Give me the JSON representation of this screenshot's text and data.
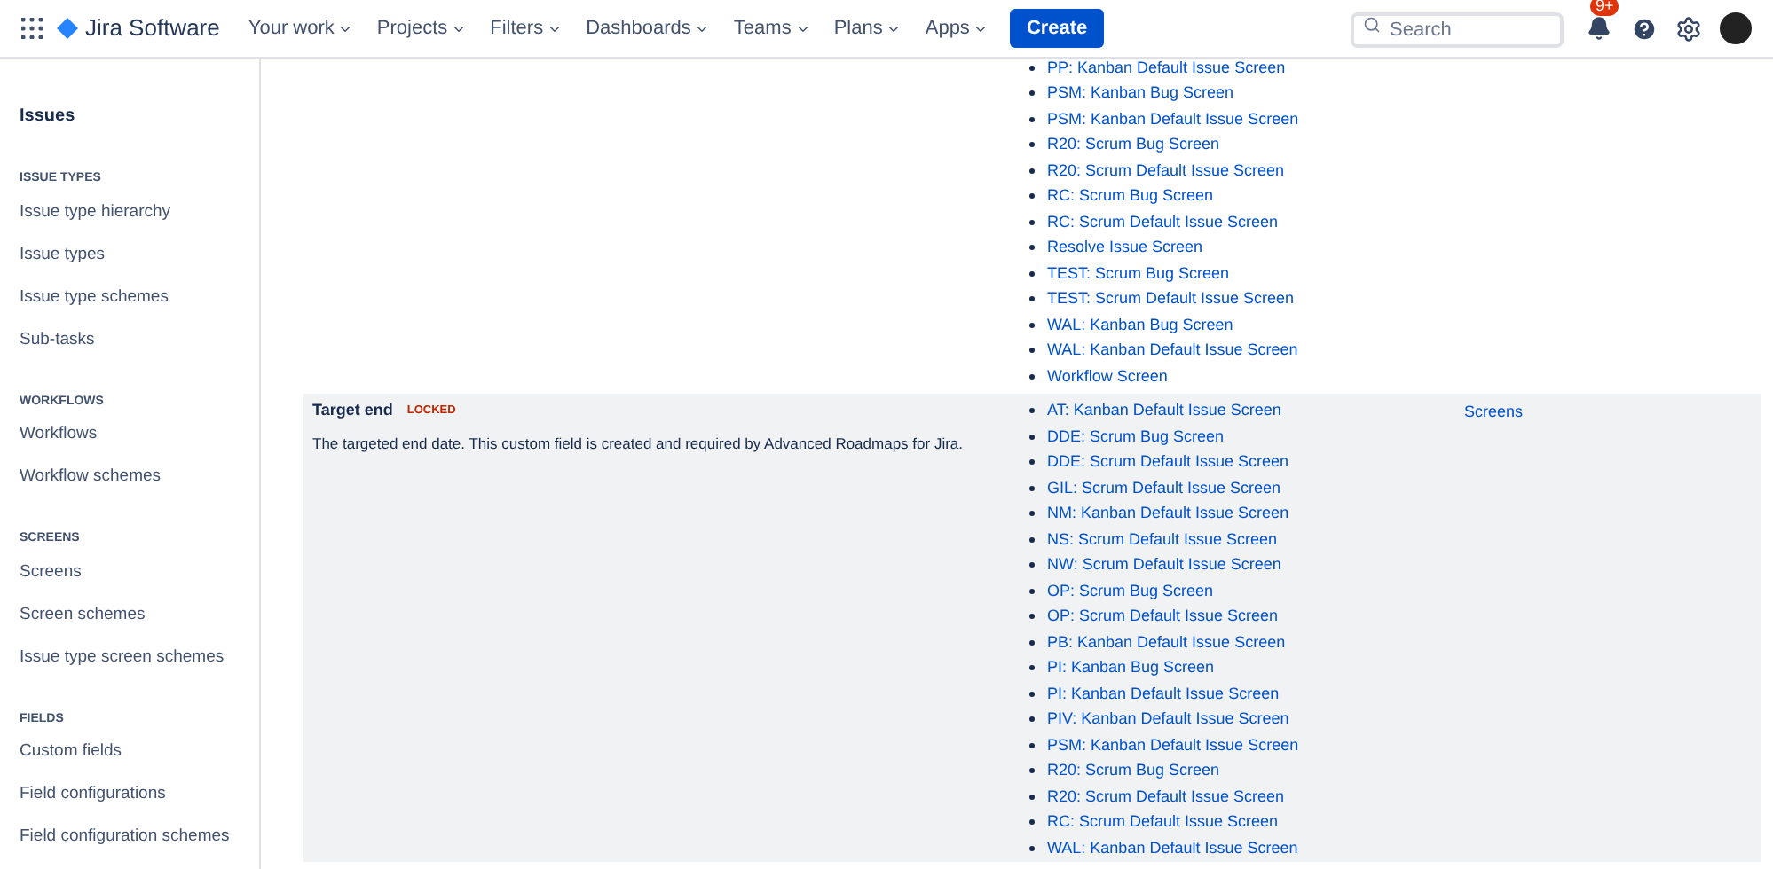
{
  "topbar": {
    "product": "Jira Software",
    "menus": [
      {
        "label": "Your work"
      },
      {
        "label": "Projects"
      },
      {
        "label": "Filters"
      },
      {
        "label": "Dashboards"
      },
      {
        "label": "Teams"
      },
      {
        "label": "Plans"
      },
      {
        "label": "Apps"
      }
    ],
    "create": "Create",
    "search": {
      "placeholder": "Search"
    },
    "notifications_badge": "9+"
  },
  "sidebar": {
    "title": "Issues",
    "sections": [
      {
        "heading": "ISSUE TYPES",
        "items": [
          "Issue type hierarchy",
          "Issue types",
          "Issue type schemes",
          "Sub-tasks"
        ]
      },
      {
        "heading": "WORKFLOWS",
        "items": [
          "Workflows",
          "Workflow schemes"
        ]
      },
      {
        "heading": "SCREENS",
        "items": [
          "Screens",
          "Screen schemes",
          "Issue type screen schemes"
        ]
      },
      {
        "heading": "FIELDS",
        "items": [
          "Custom fields",
          "Field configurations",
          "Field configuration schemes"
        ]
      }
    ]
  },
  "rows": [
    {
      "highlighted": false,
      "screens": [
        "PP: Kanban Default Issue Screen",
        "PSM: Kanban Bug Screen",
        "PSM: Kanban Default Issue Screen",
        "R20: Scrum Bug Screen",
        "R20: Scrum Default Issue Screen",
        "RC: Scrum Bug Screen",
        "RC: Scrum Default Issue Screen",
        "Resolve Issue Screen",
        "TEST: Scrum Bug Screen",
        "TEST: Scrum Default Issue Screen",
        "WAL: Kanban Bug Screen",
        "WAL: Kanban Default Issue Screen",
        "Workflow Screen"
      ]
    },
    {
      "highlighted": true,
      "name": "Target end",
      "lozenge": "LOCKED",
      "description": "The targeted end date. This custom field is created and required by Advanced Roadmaps for Jira.",
      "screens": [
        "AT: Kanban Default Issue Screen",
        "DDE: Scrum Bug Screen",
        "DDE: Scrum Default Issue Screen",
        "GIL: Scrum Default Issue Screen",
        "NM: Kanban Default Issue Screen",
        "NS: Scrum Default Issue Screen",
        "NW: Scrum Default Issue Screen",
        "OP: Scrum Bug Screen",
        "OP: Scrum Default Issue Screen",
        "PB: Kanban Default Issue Screen",
        "PI: Kanban Bug Screen",
        "PI: Kanban Default Issue Screen",
        "PIV: Kanban Default Issue Screen",
        "PSM: Kanban Default Issue Screen",
        "R20: Scrum Bug Screen",
        "R20: Scrum Default Issue Screen",
        "RC: Scrum Default Issue Screen",
        "WAL: Kanban Default Issue Screen"
      ],
      "action": "Screens"
    }
  ]
}
